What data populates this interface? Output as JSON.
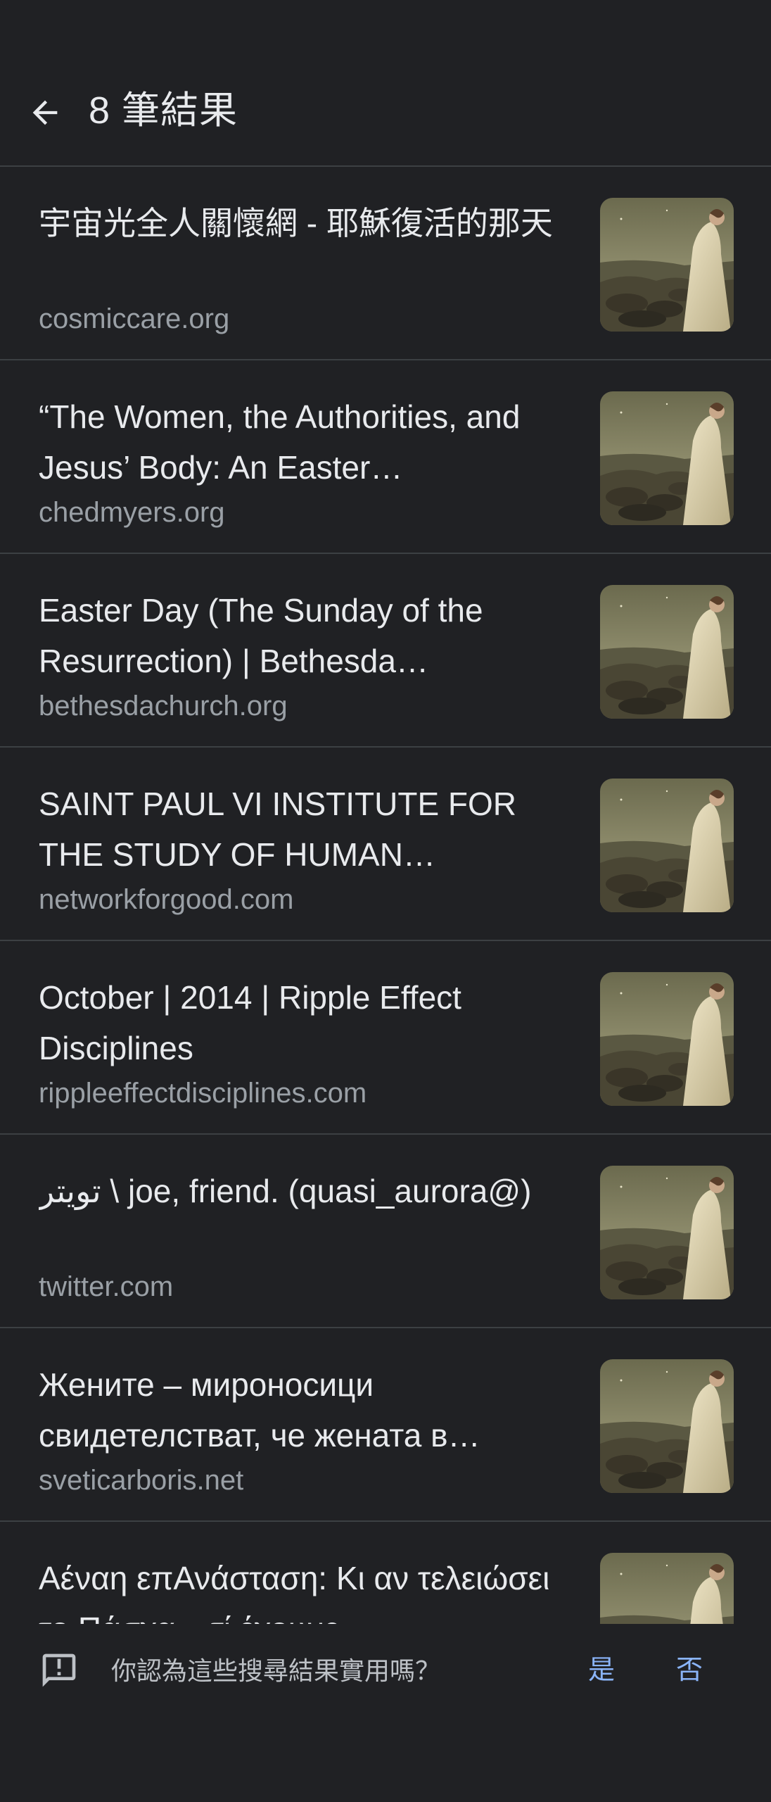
{
  "header": {
    "back_icon": "arrow-back-icon",
    "title": "8 筆結果"
  },
  "results": [
    {
      "title": "宇宙光全人關懷網 - 耶穌復活的那天",
      "domain": "cosmiccare.org",
      "thumbnail": "painting-woman-on-cliff"
    },
    {
      "title": "“The Women, the Authorities, and Jesus’ Body: An Easter…",
      "domain": "chedmyers.org",
      "thumbnail": "painting-woman-on-cliff"
    },
    {
      "title": "Easter Day (The Sunday of the Resurrection) | Bethesda…",
      "domain": "bethesdachurch.org",
      "thumbnail": "painting-woman-on-cliff"
    },
    {
      "title": "SAINT PAUL VI INSTITUTE FOR THE STUDY OF HUMAN…",
      "domain": "networkforgood.com",
      "thumbnail": "painting-woman-on-cliff"
    },
    {
      "title": "October | 2014 | Ripple Effect Disciplines",
      "domain": "rippleeffectdisciplines.com",
      "thumbnail": "painting-woman-on-cliff"
    },
    {
      "title": "تويتر \\ joe, friend. (quasi_aurora@)",
      "domain": "twitter.com",
      "thumbnail": "painting-woman-on-cliff"
    },
    {
      "title": "Жените – мироносици свидетелстват, че жената в…",
      "domain": "sveticarboris.net",
      "thumbnail": "painting-woman-on-cliff"
    },
    {
      "title": "Αέναη επΑνάσταση: Κι αν τελειώσει το Πάσχα... τί έχουμε…",
      "domain": "",
      "thumbnail": "painting-woman-on-cliff"
    }
  ],
  "feedback": {
    "icon": "feedback-icon",
    "question": "你認為這些搜尋結果實用嗎？",
    "yes_label": "是",
    "no_label": "否"
  },
  "colors": {
    "background": "#202124",
    "divider": "#3c4043",
    "title_text": "#e8eaed",
    "domain_text": "#9aa0a6",
    "link_accent": "#8ab4f8"
  }
}
